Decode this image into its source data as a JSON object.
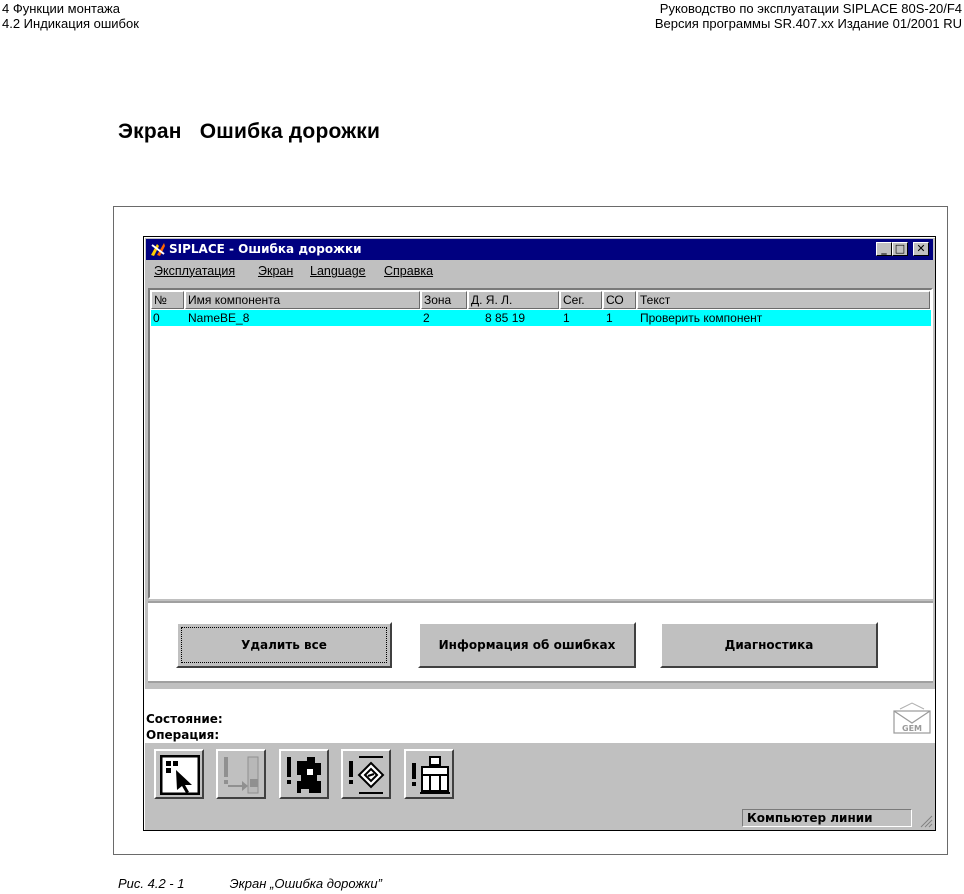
{
  "doc_header": {
    "left_line1": "4 Функции монтажа",
    "left_line2": "4.2 Индикация ошибок",
    "right_line1": "Руководство по эксплуатации SIPLACE 80S-20/F4",
    "right_line2": "Версия программы SR.407.xx  Издание 01/2001 RU"
  },
  "page_title": "Экран   Ошибка дорожки",
  "caption": {
    "number": "Рис. 4.2 - 1",
    "text": "Экран „Ошибка дорожки”"
  },
  "window": {
    "title": "SIPLACE - Ошибка дорожки",
    "controls": {
      "minimize": "_",
      "maximize": "□",
      "close": "✕"
    },
    "menu": [
      "Эксплуатация",
      "Экран",
      "Language",
      "Справка"
    ],
    "list": {
      "columns": [
        "№",
        "Имя компонента",
        "Зона",
        "Д. Я. Л.",
        "Сег.",
        "СО",
        "Текст"
      ],
      "rows": [
        {
          "no": "0",
          "name": "NameBE_8",
          "zone": "2",
          "dyl": "8 85 19",
          "seg": "1",
          "co": "1",
          "text": "Проверить компонент"
        }
      ]
    },
    "buttons": {
      "delete_all": "Удалить все",
      "error_info": "Информация об ошибках",
      "diagnostics": "Диагностика"
    },
    "status": {
      "state_label": "Состояние:",
      "operation_label": "Операция:",
      "gem_label": "GEM"
    },
    "toolbar_icons": [
      "select-pointer-icon",
      "error-transfer-icon",
      "error-puzzle-icon",
      "error-feeder-icon",
      "error-machine-icon"
    ],
    "statusbar": {
      "field": "Компьютер линии"
    },
    "colors": {
      "titlebar": "#000080",
      "selected_row": "#00ffff",
      "face": "#c0c0c0"
    }
  }
}
